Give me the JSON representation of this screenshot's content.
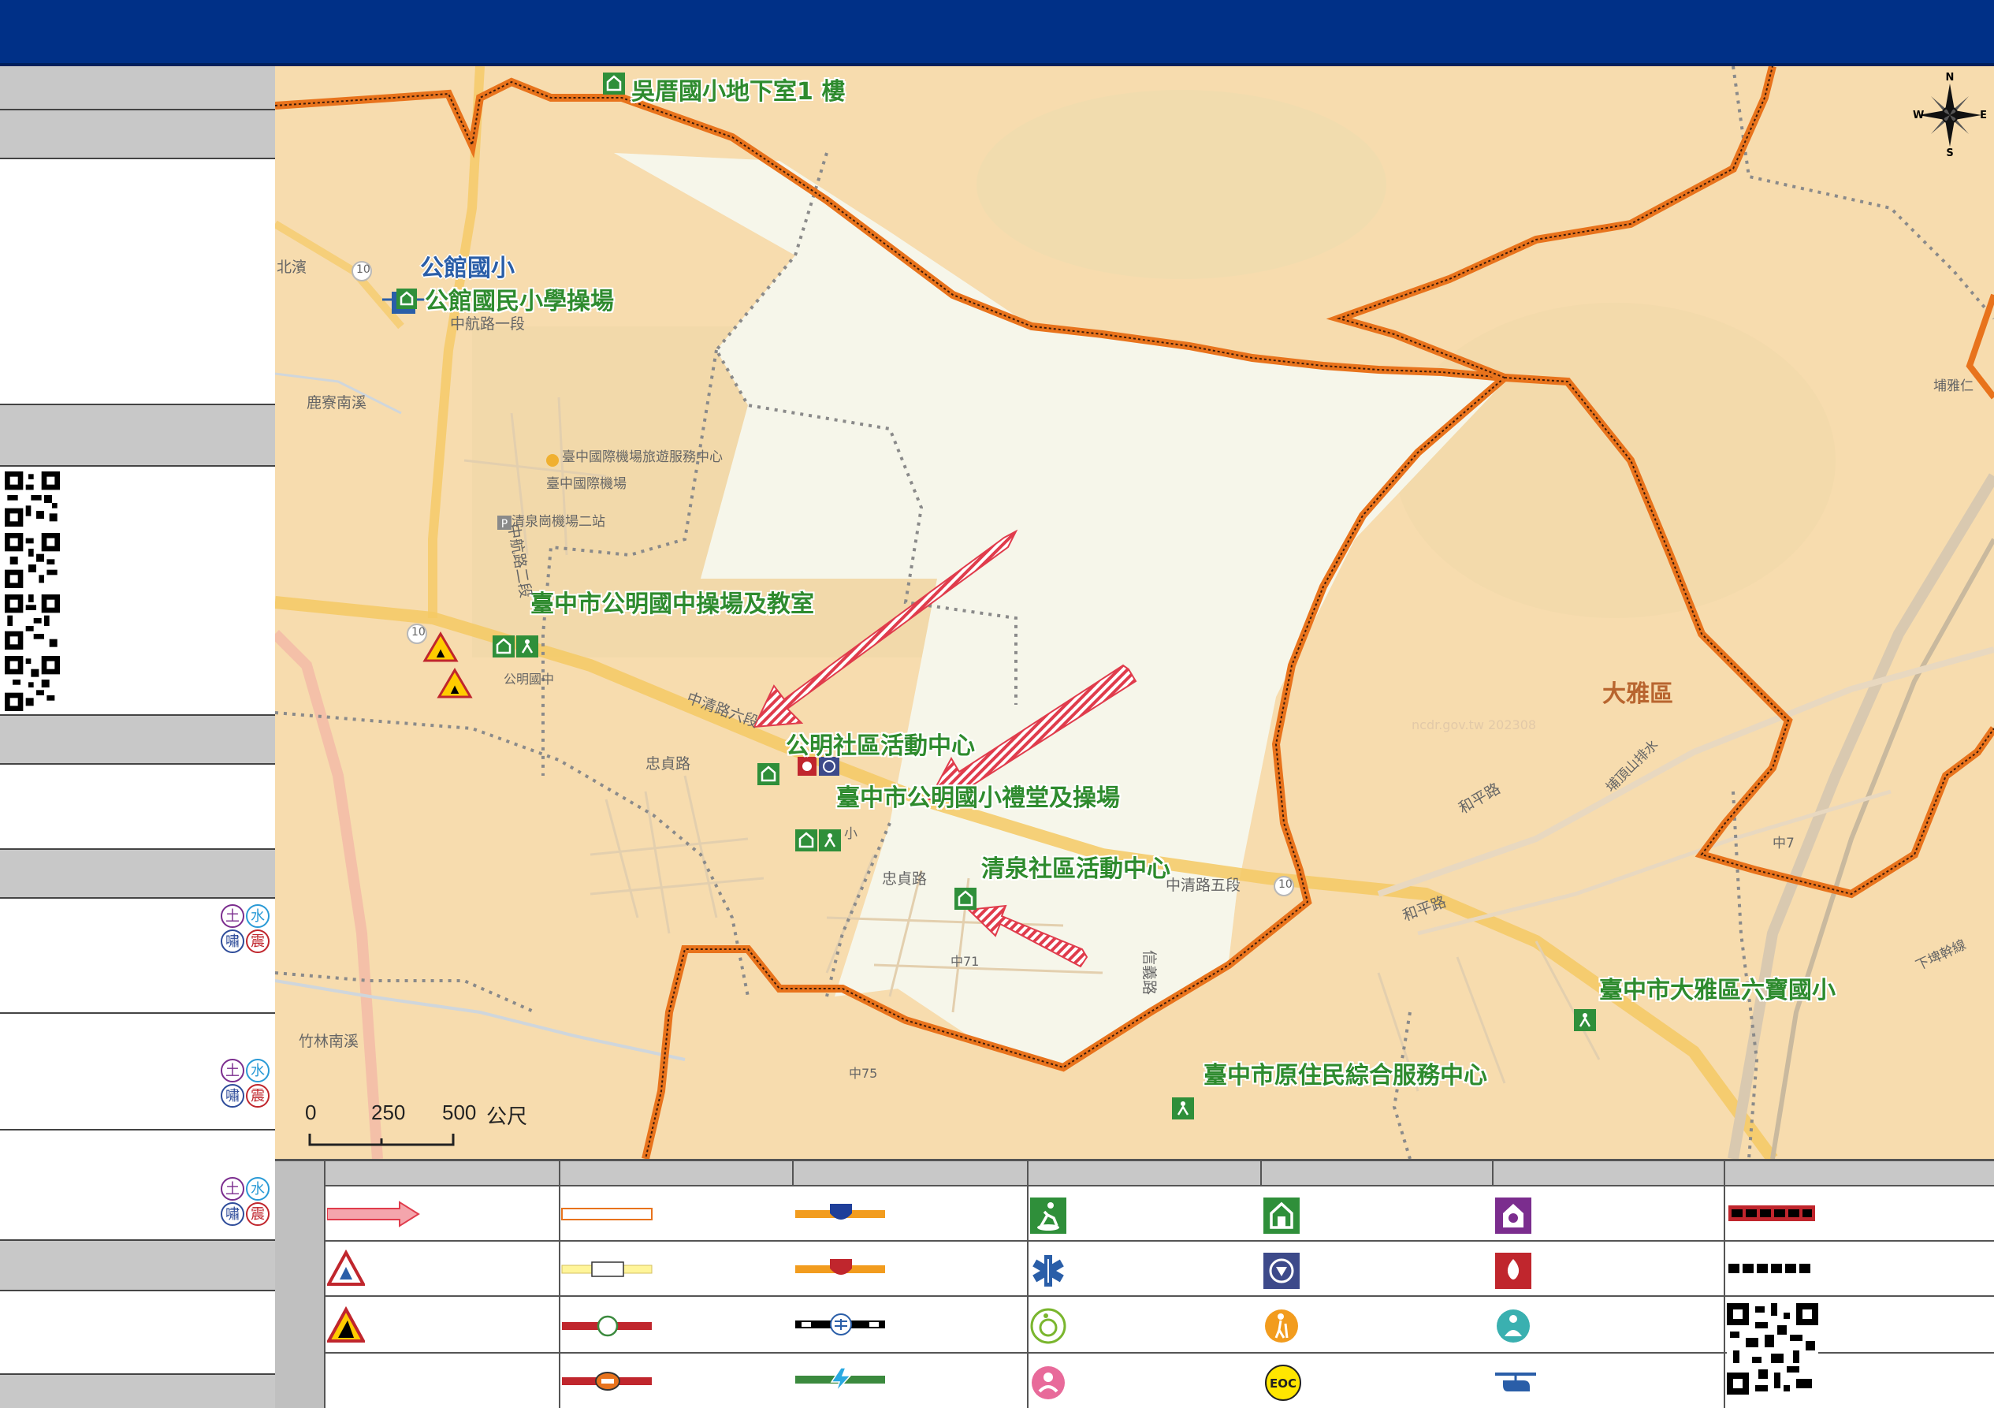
{
  "map": {
    "labels": {
      "school_underground": "吳厝國小地下室1 樓",
      "gongguan_elementary": "公館國小",
      "gongguan_field": "公館國民小學操場",
      "gongming_junior": "臺中市公明國中操場及教室",
      "gongming_community": "公明社區活動中心",
      "gongming_elementary": "臺中市公明國小禮堂及操場",
      "qingquan_community": "清泉社區活動中心",
      "dayadistrict": "大雅區",
      "liubao_elementary": "臺中市大雅區六寶國小",
      "aboriginal_center": "臺中市原住民綜合服務中心"
    },
    "road_labels": {
      "r1": "中航路一段",
      "r2": "中清路六段",
      "r3": "中清路五段",
      "r4": "中航路二段",
      "r5": "忠貞路",
      "r6": "忠貞路",
      "r7": "信義路",
      "r8": "和平路",
      "r9": "和平路",
      "r10": "鹿寮南溪",
      "r11": "竹林南溪",
      "r12": "北濱",
      "r13": "公明國中",
      "r14": "中71",
      "r15": "中75",
      "r16": "臺中國際機場",
      "r17": "臺中國際機場旅遊服務中心",
      "r18": "清泉崗機場二站",
      "r19": "下埤幹線",
      "r20": "埔雅仁",
      "r21": "中7",
      "r22": "埔頂山排水",
      "r23": "小",
      "r24": "ncdr.gov.tw 202308",
      "r25": "10",
      "r26": "10",
      "r27": "10"
    },
    "scale": {
      "ticks": [
        "0",
        "250",
        "500"
      ],
      "unit": "公尺"
    },
    "compass": {
      "n": "N",
      "s": "S",
      "e": "E",
      "w": "W"
    }
  },
  "sidebar": {
    "hazard_badges": {
      "soil": "土",
      "water": "水",
      "tsunami": "嘯",
      "quake": "震"
    }
  },
  "legend": {
    "eoc_label": "EOC"
  },
  "colors": {
    "header": "#003087",
    "boundary": "#e8731c",
    "arrow": "#e03c4c",
    "shelter_green": "#2f8f3a",
    "map_base": "#f7dcae"
  }
}
